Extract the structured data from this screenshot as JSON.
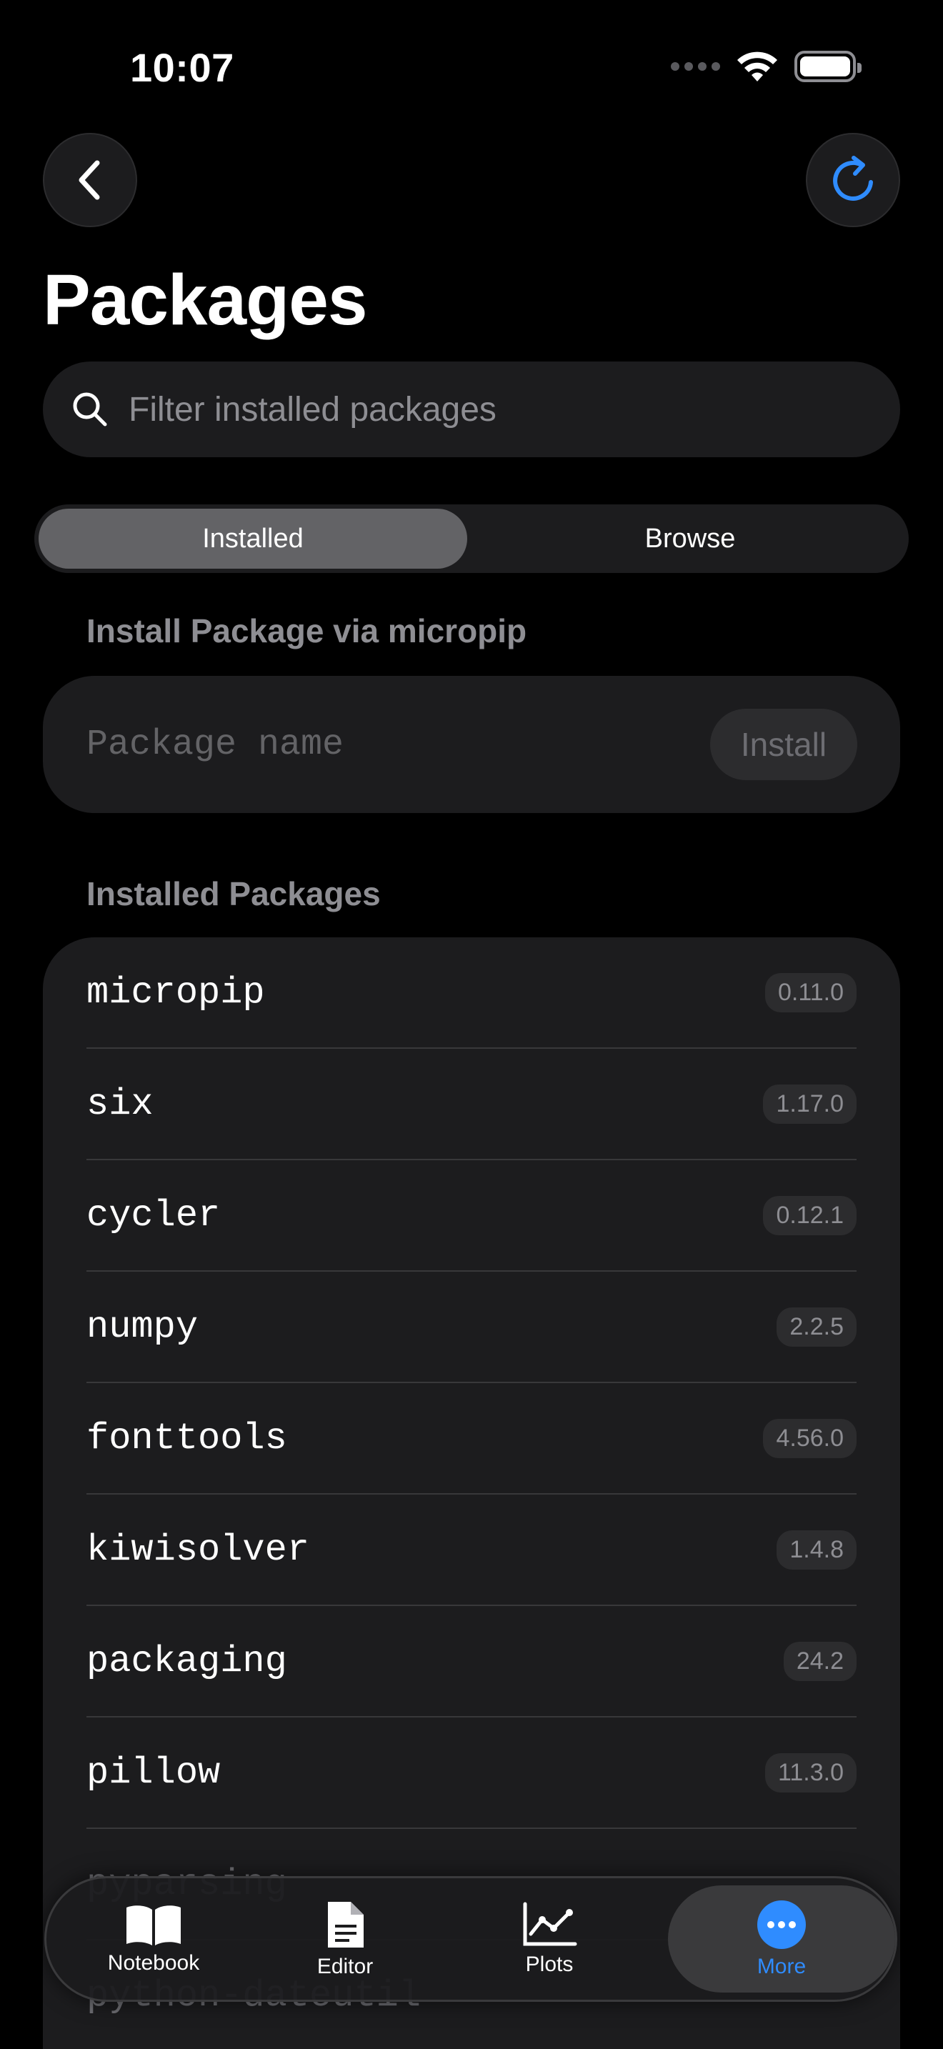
{
  "status": {
    "time": "10:07"
  },
  "header": {
    "title": "Packages"
  },
  "search": {
    "placeholder": "Filter installed packages",
    "value": ""
  },
  "segments": {
    "installed": "Installed",
    "browse": "Browse",
    "selected": "Installed"
  },
  "install_section": {
    "label": "Install Package via micropip",
    "input_placeholder": "Package name",
    "button_label": "Install"
  },
  "installed_section": {
    "label": "Installed Packages"
  },
  "packages": [
    {
      "name": "micropip",
      "version": "0.11.0"
    },
    {
      "name": "six",
      "version": "1.17.0"
    },
    {
      "name": "cycler",
      "version": "0.12.1"
    },
    {
      "name": "numpy",
      "version": "2.2.5"
    },
    {
      "name": "fonttools",
      "version": "4.56.0"
    },
    {
      "name": "kiwisolver",
      "version": "1.4.8"
    },
    {
      "name": "packaging",
      "version": "24.2"
    },
    {
      "name": "pillow",
      "version": "11.3.0"
    },
    {
      "name": "pyparsing",
      "version": ""
    },
    {
      "name": "python-dateutil",
      "version": ""
    }
  ],
  "tabbar": {
    "tabs": [
      {
        "label": "Notebook",
        "icon": "book-icon"
      },
      {
        "label": "Editor",
        "icon": "document-icon"
      },
      {
        "label": "Plots",
        "icon": "line-chart-icon"
      },
      {
        "label": "More",
        "icon": "ellipsis-circle-icon",
        "active": true
      }
    ]
  },
  "colors": {
    "accent": "#2f8cff",
    "background": "#000000",
    "card": "#1c1c1e",
    "secondary_text": "#8e8e93"
  }
}
